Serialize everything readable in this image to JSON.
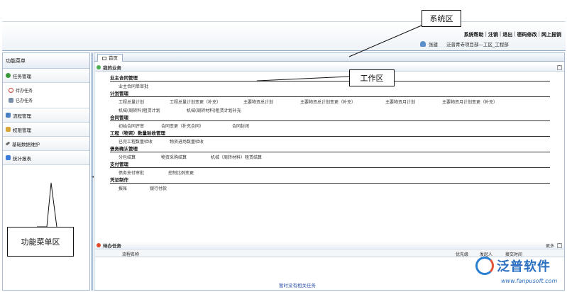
{
  "header": {
    "system_links": [
      "系统帮助",
      "注销",
      "退出",
      "密码修改",
      "网上报销"
    ],
    "user_name": "张建",
    "department": "泛普青寺项目部—工区_工程部"
  },
  "left_menu": {
    "title": "功能菜单",
    "groups": [
      {
        "label": "任务管理",
        "sub_items": [
          "待办任务",
          "已办任务"
        ]
      },
      {
        "label": "流程管理"
      },
      {
        "label": "权限管理"
      },
      {
        "label": "基础数据维护"
      },
      {
        "label": "统计报表"
      }
    ]
  },
  "work_area": {
    "tab_home": "首页",
    "my_business_title": "我的业务",
    "categories": [
      {
        "title": "业主合同管理",
        "rows": [
          [
            "业主合同单审批"
          ]
        ]
      },
      {
        "title": "计划管理",
        "rows": [
          [
            "工程总量计划",
            "工程总量计划变更（补充）",
            "主要物资总计划",
            "主要物资总计划变更（补充）",
            "主要物资月计划",
            "主要物资月计划变更（补充）"
          ],
          [
            "机械(周转料)租赁计划",
            "机械(周转材料)租赁计划补充"
          ]
        ]
      },
      {
        "title": "合同管理",
        "rows": [
          [
            "初始合同评审",
            "合同变更（补充合同）",
            "合同封闭"
          ]
        ]
      },
      {
        "title": "工程（物资）数量验收管理",
        "rows": [
          [
            "已完工程数量验收",
            "物资进场数量验收"
          ]
        ]
      },
      {
        "title": "债务确认管理",
        "rows": [
          [
            "分包结算",
            "物资采购结算",
            "机械（周转材料）租赁结算"
          ]
        ]
      },
      {
        "title": "支付管理",
        "rows": [
          [
            "债务支付审批",
            "控制比例变更"
          ]
        ]
      },
      {
        "title": "凭证制作",
        "rows": [
          [
            "报账",
            "银行付款"
          ]
        ]
      }
    ],
    "pending": {
      "title": "待办任务",
      "more_label": "更多",
      "columns": [
        "流程名称",
        "优先级",
        "发起人",
        "接交时间"
      ],
      "empty_message": "暂时没有相关任务"
    }
  },
  "annotations": {
    "system_area": "系统区",
    "work_area": "工作区",
    "menu_area": "功能菜单区"
  },
  "brand": {
    "name": "泛普软件",
    "url": "www.fanpusoft.com"
  }
}
